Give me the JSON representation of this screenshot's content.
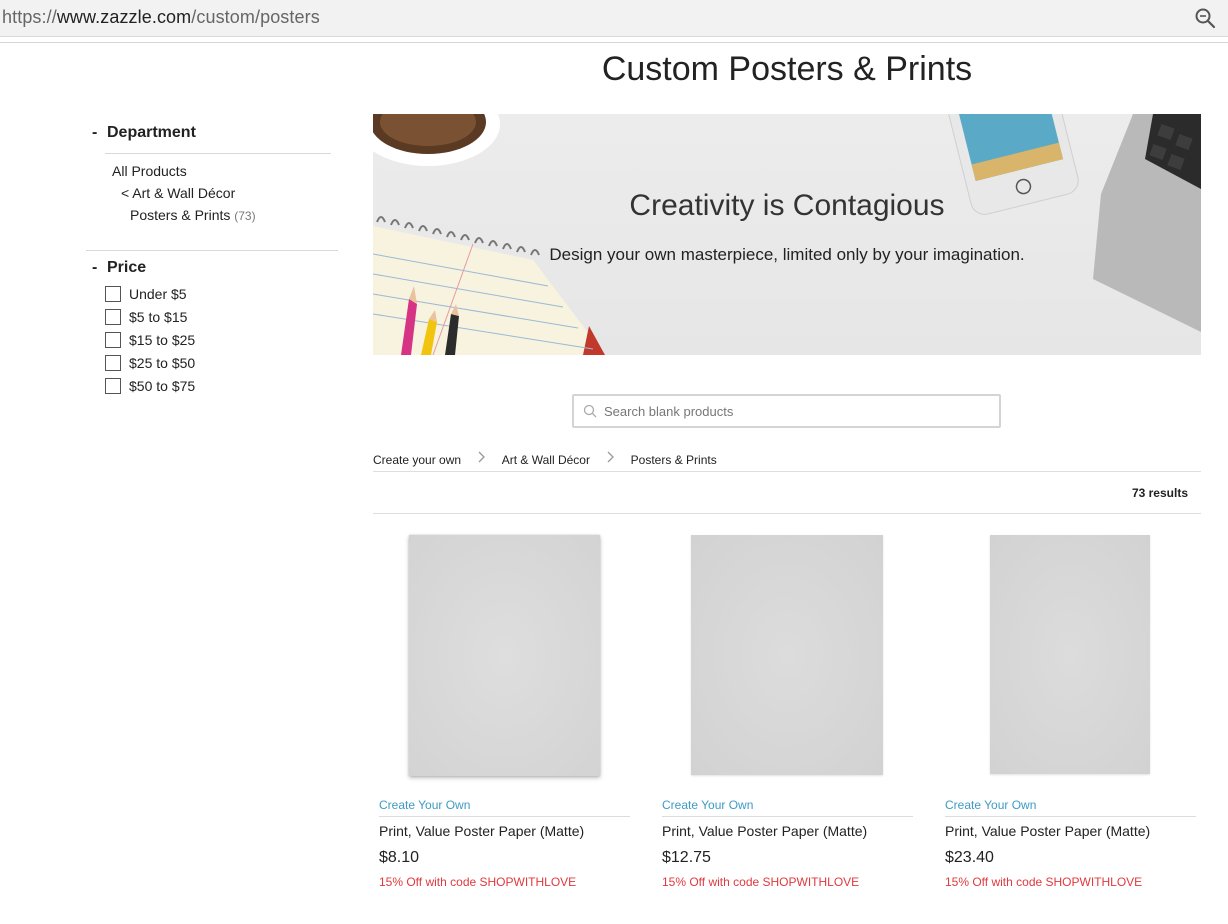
{
  "browser": {
    "url_scheme": "https://",
    "url_host": "www.zazzle.com",
    "url_path": "/custom/posters"
  },
  "page": {
    "title": "Custom Posters & Prints"
  },
  "sidebar": {
    "department": {
      "heading": "Department",
      "toggle": "-",
      "links": [
        {
          "label": "All Products"
        },
        {
          "label": "< Art & Wall Décor"
        },
        {
          "label": "Posters & Prints",
          "count": "(73)"
        }
      ]
    },
    "price": {
      "heading": "Price",
      "toggle": "-",
      "options": [
        {
          "label": "Under $5",
          "checked": false
        },
        {
          "label": "$5 to $15",
          "checked": false
        },
        {
          "label": "$15 to $25",
          "checked": false
        },
        {
          "label": "$25 to $50",
          "checked": false
        },
        {
          "label": "$50 to $75",
          "checked": false
        }
      ]
    }
  },
  "banner": {
    "title": "Creativity is Contagious",
    "subtitle": "Design your own masterpiece, limited only by your imagination."
  },
  "search": {
    "placeholder": "Search blank products",
    "value": ""
  },
  "breadcrumb": [
    "Create your own",
    "Art & Wall Décor",
    "Posters & Prints"
  ],
  "results": {
    "label": "73 results"
  },
  "products": [
    {
      "tag": "Create Your Own",
      "name": "Print, Value Poster Paper (Matte)",
      "price": "$8.10",
      "promo": "15% Off with code SHOPWITHLOVE"
    },
    {
      "tag": "Create Your Own",
      "name": "Print, Value Poster Paper (Matte)",
      "price": "$12.75",
      "promo": "15% Off with code SHOPWITHLOVE"
    },
    {
      "tag": "Create Your Own",
      "name": "Print, Value Poster Paper (Matte)",
      "price": "$23.40",
      "promo": "15% Off with code SHOPWITHLOVE"
    }
  ],
  "colors": {
    "link_blue": "#3d9bc5",
    "promo_red": "#e0393e",
    "text": "#222222"
  },
  "icons": {
    "zoom": "magnifier-icon",
    "search": "search-icon",
    "chevron": "chevron-right-icon"
  }
}
